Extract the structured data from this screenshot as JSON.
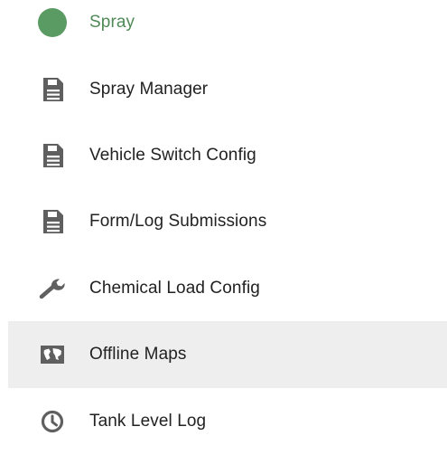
{
  "colors": {
    "accent": "#5a9a63",
    "accent_text": "#4f8a57",
    "icon": "#5f5f5f",
    "text": "#222222",
    "selected_bg": "#eeeeee"
  },
  "menu": {
    "items": [
      {
        "label": "Spray",
        "icon": "circle-icon",
        "active": true
      },
      {
        "label": "Spray Manager",
        "icon": "save-icon"
      },
      {
        "label": "Vehicle Switch Config",
        "icon": "save-icon"
      },
      {
        "label": "Form/Log Submissions",
        "icon": "save-icon"
      },
      {
        "label": "Chemical Load Config",
        "icon": "wrench-icon"
      },
      {
        "label": "Offline Maps",
        "icon": "map-icon",
        "selected": true
      },
      {
        "label": "Tank Level Log",
        "icon": "clock-icon"
      }
    ]
  }
}
